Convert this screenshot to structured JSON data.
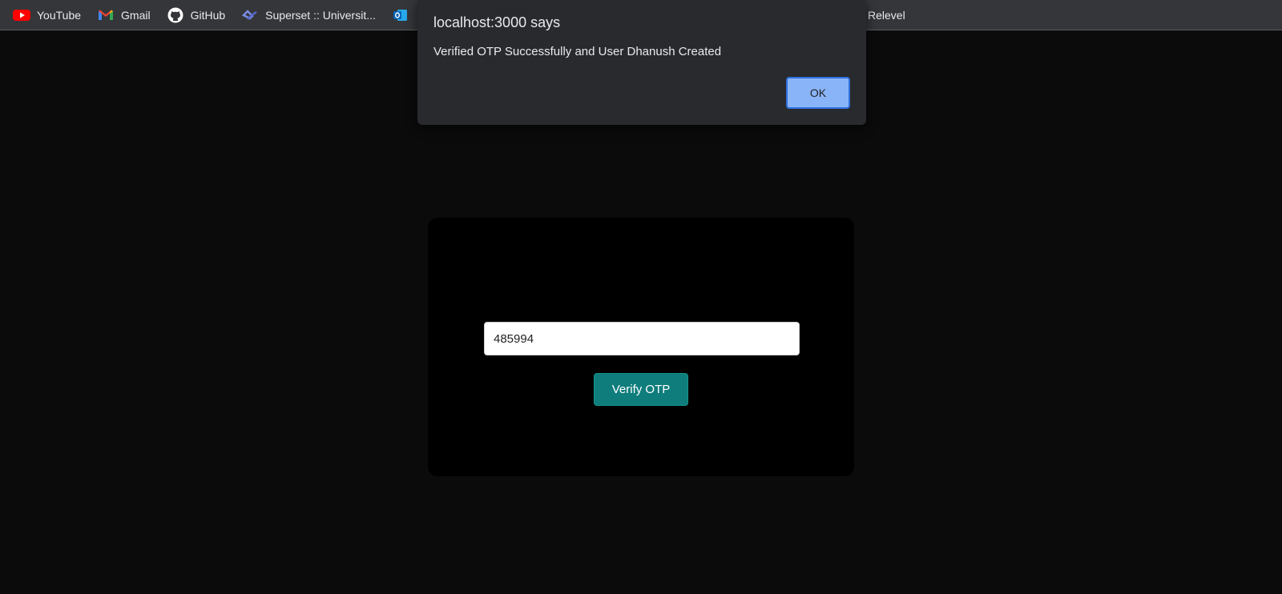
{
  "bookmarks": [
    {
      "label": "YouTube",
      "icon": "youtube-icon"
    },
    {
      "label": "Gmail",
      "icon": "gmail-icon"
    },
    {
      "label": "GitHub",
      "icon": "github-icon"
    },
    {
      "label": "Superset :: Universit...",
      "icon": "superset-icon"
    },
    {
      "label": "",
      "icon": "outlook-icon"
    }
  ],
  "bookmark_right": {
    "label": "Relevel"
  },
  "otp": {
    "value": "485994",
    "button_label": "Verify OTP"
  },
  "alert": {
    "title": "localhost:3000 says",
    "message": "Verified OTP Successfully and User Dhanush Created",
    "ok_label": "OK"
  },
  "colors": {
    "page_bg": "#0b0b0b",
    "card_bg": "#000000",
    "verify_button": "#0e7d7b",
    "ok_button": "#8ab4f8",
    "dialog_bg": "#292a2d"
  }
}
